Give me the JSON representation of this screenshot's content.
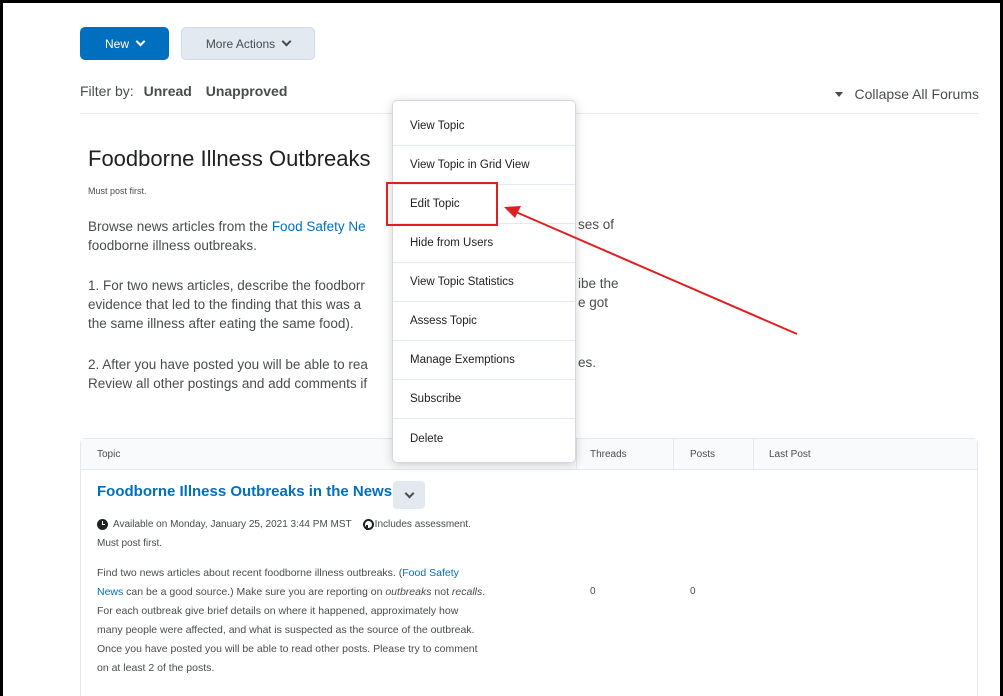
{
  "toolbar": {
    "new_label": "New",
    "more_actions_label": "More Actions"
  },
  "filter": {
    "label": "Filter by:",
    "unread": "Unread",
    "unapproved": "Unapproved",
    "collapse_all": "Collapse All Forums"
  },
  "forum": {
    "title": "Foodborne Illness Outbreaks",
    "must_post": "Must post first.",
    "p1_a": "Browse news articles from the ",
    "p1_link": "Food Safety Ne",
    "p1_right": "ses of",
    "p1_line2": "foodborne illness outbreaks.",
    "p2_line1": "1. For two news articles, describe the foodborr",
    "p2_right1": "ibe the",
    "p2_line2": "evidence that led to the finding that this was a",
    "p2_right2": "e got",
    "p2_line3": "the same illness after eating the same food).",
    "p3_line1": "2. After you have posted you will be able to rea",
    "p3_right1": "es.",
    "p3_line2": "Review all other postings and add comments if"
  },
  "table": {
    "headers": {
      "topic": "Topic",
      "threads": "Threads",
      "posts": "Posts",
      "last_post": "Last Post"
    },
    "row": {
      "topic_title": "Foodborne Illness Outbreaks in the News",
      "available": "Available on Monday, January 25, 2021 3:44 PM MST",
      "includes_assessment": "Includes assessment.",
      "must_post": "Must post first.",
      "desc_1a": "Find two news articles about recent foodborne illness outbreaks. (",
      "desc_1link": "Food Safety",
      "desc_2link": "News",
      "desc_2a": " can be a good source.) Make sure you are reporting on ",
      "desc_2em1": "outbreaks",
      "desc_2b": " not ",
      "desc_2em2": "recalls",
      "desc_2c": ".",
      "desc_3": "For each outbreak give brief details on where it happened, approximately how",
      "desc_4": "many people were affected, and what is suspected as the source of the outbreak.",
      "desc_5": "Once you have posted you will be able to read other posts. Please try to comment",
      "desc_6": "on at least 2 of the posts.",
      "threads": "0",
      "posts": "0"
    }
  },
  "menu": {
    "items": [
      "View Topic",
      "View Topic in Grid View",
      "Edit Topic",
      "Hide from Users",
      "View Topic Statistics",
      "Assess Topic",
      "Manage Exemptions",
      "Subscribe",
      "Delete"
    ]
  },
  "colors": {
    "primary": "#006fbf",
    "highlight": "#e02020",
    "button_secondary": "#e3e9f1"
  }
}
